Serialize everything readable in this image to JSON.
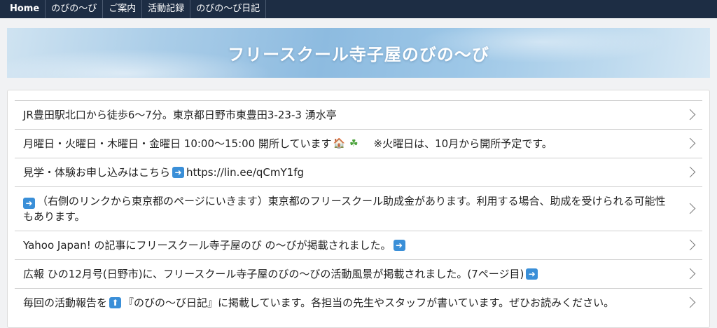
{
  "nav": {
    "items": [
      "Home",
      "のびの〜び",
      "ご案内",
      "活動記録",
      "のびの〜び日記"
    ]
  },
  "banner": {
    "title": "フリースクール寺子屋のびの〜び"
  },
  "list": {
    "item1": "JR豊田駅北口から徒歩6〜7分。東京都日野市東豊田3-23-3 湧水亭",
    "item2_pre": "月曜日・火曜日・木曜日・金曜日 10:00〜15:00 開所しています",
    "item2_post": "※火曜日は、10月から開所予定です。",
    "item3_pre": "見学・体験お申し込みはこちら",
    "item3_url": "https://lin.ee/qCmY1fg",
    "item4": "（右側のリンクから東京都のページにいきます）東京都のフリースクール助成金があります。利用する場合、助成を受けられる可能性もあります。",
    "item5": "Yahoo Japan! の記事にフリースクール寺子屋のび の〜びが掲載されました。",
    "item6": "広報 ひの12月号(日野市)に、フリースクール寺子屋のびの〜びの活動風景が掲載されました。(7ページ目)",
    "item7_pre": "毎回の活動報告を",
    "item7_post": "『のびの〜び日記』に掲載しています。各担当の先生やスタッフが書いています。ぜひお読みください。"
  },
  "icons": {
    "arrow": "right-arrow-icon",
    "arrow_up": "up-arrow-icon",
    "house": "house-icon",
    "leaf": "clover-icon",
    "chevron": "chevron-right-icon"
  },
  "colors": {
    "nav_bg": "#1d2d44",
    "accent_blue": "#3a8fd8"
  }
}
